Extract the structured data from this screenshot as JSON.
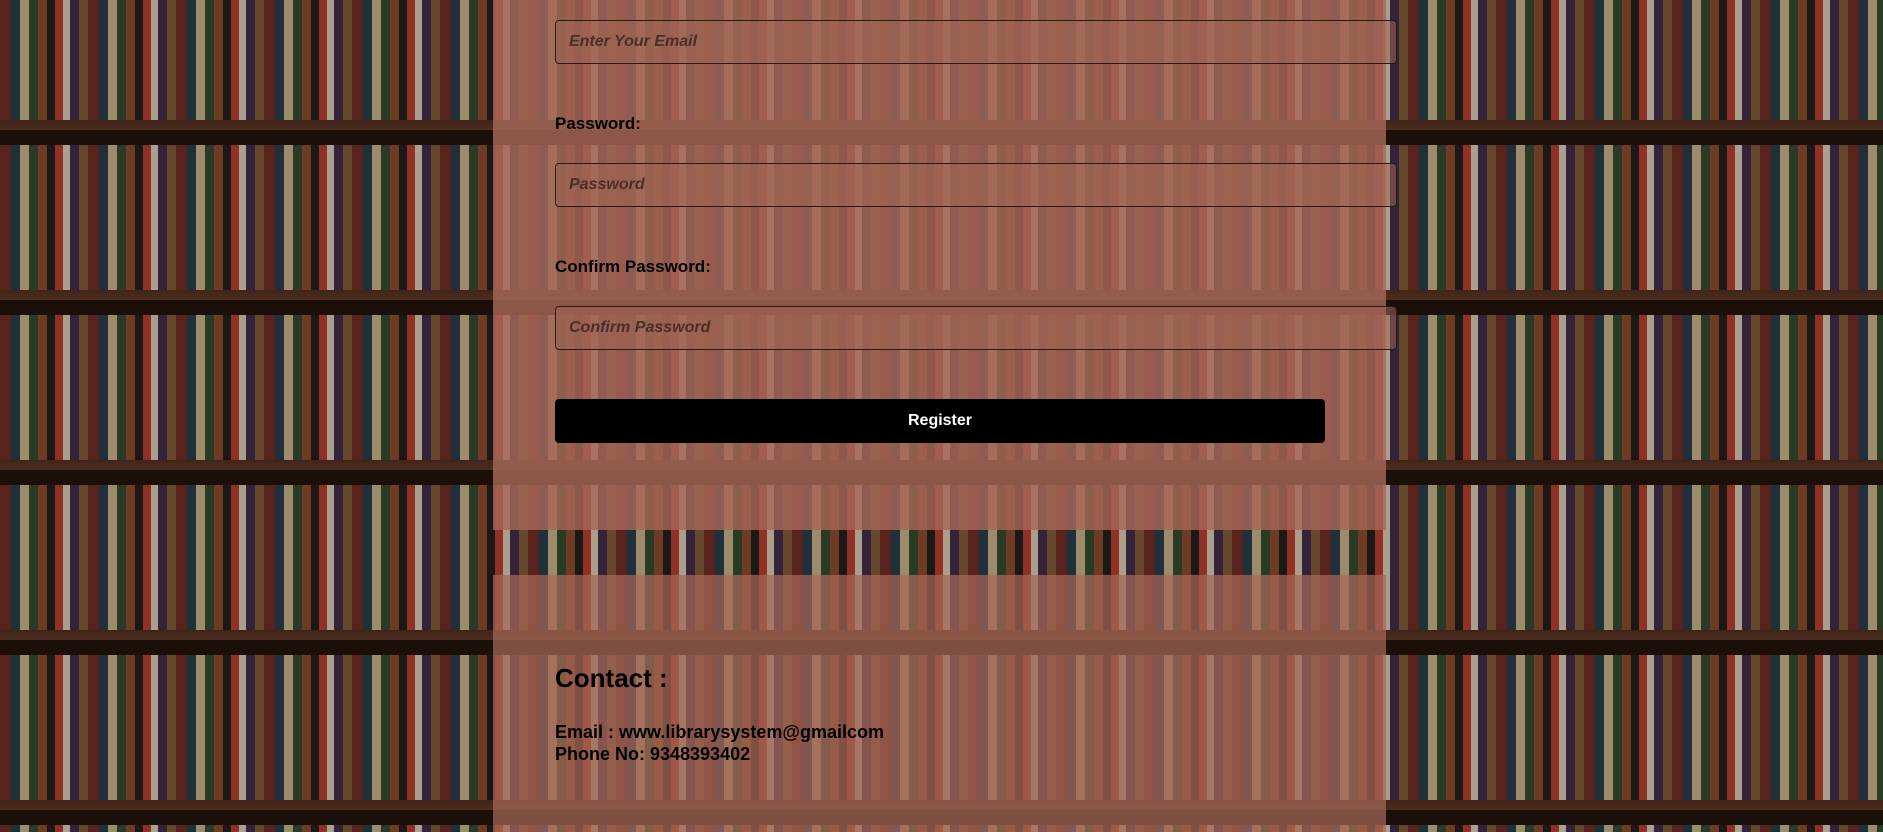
{
  "form": {
    "email_placeholder": "Enter Your Email",
    "password_label": "Password:",
    "password_placeholder": "Password",
    "confirm_password_label": "Confirm Password:",
    "confirm_password_placeholder": "Confirm Password",
    "register_label": "Register"
  },
  "contact": {
    "title": "Contact :",
    "email_line": "Email : www.librarysystem@gmailcom",
    "phone_line": "Phone No: 9348393402"
  },
  "colors": {
    "panel": "#a66858",
    "button": "#000000",
    "button_text": "#ffffff"
  }
}
